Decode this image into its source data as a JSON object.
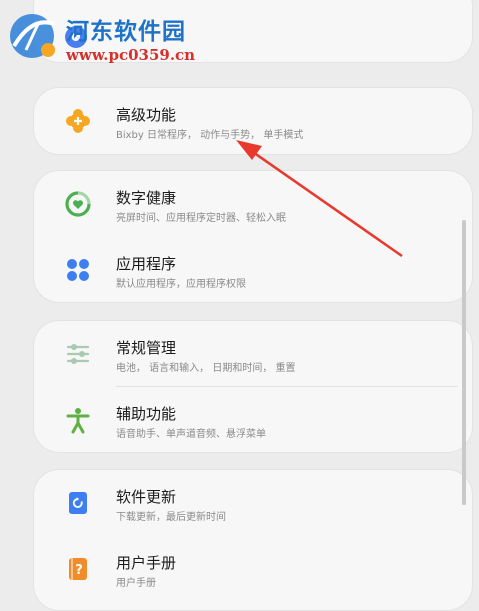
{
  "watermark": {
    "title": "河东软件园",
    "url": "www.pc0359.cn"
  },
  "top_partial": {
    "icon": "google-g-icon"
  },
  "settings": [
    {
      "title": "高级功能",
      "subtitle": "Bixby 日常程序， 动作与手势， 单手模式",
      "icon": "advanced-features-icon",
      "color": "#f5a623"
    },
    {
      "title": "数字健康",
      "subtitle": "亮屏时间、应用程序定时器、轻松入眠",
      "icon": "digital-wellbeing-icon",
      "color": "#4caf50"
    },
    {
      "title": "应用程序",
      "subtitle": "默认应用程序，应用程序权限",
      "icon": "apps-icon",
      "color": "#3d7ff0"
    },
    {
      "title": "常规管理",
      "subtitle": "电池， 语言和输入， 日期和时间， 重置",
      "icon": "sliders-icon",
      "color": "#a8c9b2"
    },
    {
      "title": "辅助功能",
      "subtitle": "语音助手、单声道音频、悬浮菜单",
      "icon": "accessibility-icon",
      "color": "#5eb043"
    },
    {
      "title": "软件更新",
      "subtitle": "下载更新，最后更新时间",
      "icon": "software-update-icon",
      "color": "#3d7ff0"
    },
    {
      "title": "用户手册",
      "subtitle": "用户手册",
      "icon": "user-manual-icon",
      "color": "#f08c2a"
    }
  ],
  "annotation": {
    "arrow_color": "#e8392f"
  }
}
